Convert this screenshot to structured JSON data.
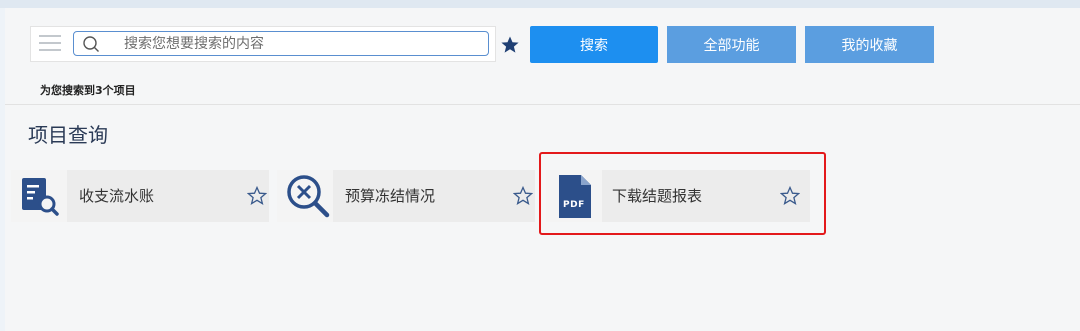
{
  "search": {
    "placeholder": "搜索您想要搜索的内容"
  },
  "buttons": {
    "search": "搜索",
    "all_features": "全部功能",
    "my_favorites": "我的收藏"
  },
  "result_text": "为您搜索到3个项目",
  "section_title": "项目查询",
  "cards": [
    {
      "label": "收支流水账",
      "icon": "document-search-icon"
    },
    {
      "label": "预算冻结情况",
      "icon": "magnifier-x-icon"
    },
    {
      "label": "下载结题报表",
      "icon": "pdf-file-icon",
      "icon_text": "PDF"
    }
  ],
  "colors": {
    "primary_button": "#1d8ff0",
    "secondary_button": "#5b9ee0",
    "icon_navy": "#2c4f8a",
    "highlight_red": "#e3191b"
  }
}
